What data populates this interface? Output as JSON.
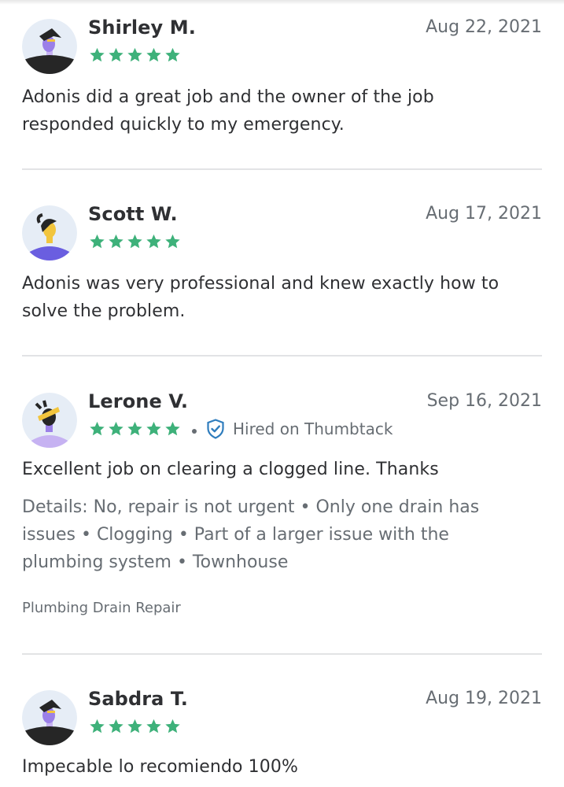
{
  "reviews": [
    {
      "name": "Shirley M.",
      "date": "Aug 22, 2021",
      "rating": 5,
      "avatar": "hat-person-avatar",
      "text": "Adonis did a great job and the owner of the job responded quickly to my emergency."
    },
    {
      "name": "Scott W.",
      "date": "Aug 17, 2021",
      "rating": 5,
      "avatar": "ponytail-person-avatar",
      "text": "Adonis was very professional and knew exactly how to solve the problem."
    },
    {
      "name": "Lerone V.",
      "date": "Sep 16, 2021",
      "rating": 5,
      "avatar": "headband-person-avatar",
      "hired_label": "Hired on Thumbtack",
      "text": "Excellent job on clearing a clogged line. Thanks",
      "details": "Details: No, repair is not urgent • Only one drain has issues • Clogging • Part of a larger issue with the plumbing system • Townhouse",
      "category": "Plumbing Drain Repair"
    },
    {
      "name": "Sabdra T.",
      "date": "Aug 19, 2021",
      "rating": 5,
      "avatar": "hat-person-avatar",
      "text": "Impecable lo recomiendo 100%"
    }
  ],
  "colors": {
    "star": "#3eb17a",
    "verified": "#2f7dbd",
    "text_primary": "#2f3033",
    "text_secondary": "#676d73",
    "divider": "#e2e3e5"
  }
}
